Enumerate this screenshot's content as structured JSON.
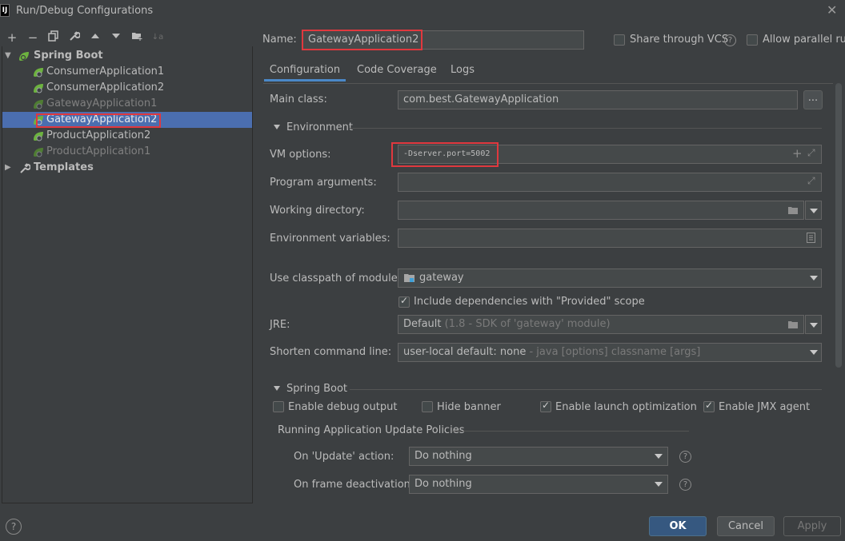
{
  "window": {
    "title": "Run/Debug Configurations",
    "app_icon_text": "IJ"
  },
  "tree": {
    "root_label": "Spring Boot",
    "items": [
      {
        "label": "ConsumerApplication1",
        "muted": false
      },
      {
        "label": "ConsumerApplication2",
        "muted": false
      },
      {
        "label": "GatewayApplication1",
        "muted": true
      },
      {
        "label": "GatewayApplication2",
        "muted": false,
        "selected": true
      },
      {
        "label": "ProductApplication2",
        "muted": false
      },
      {
        "label": "ProductApplication1",
        "muted": true
      }
    ],
    "templates_label": "Templates"
  },
  "header": {
    "name_label": "Name:",
    "name_value": "GatewayApplication2",
    "share_vcs_label": "Share through VCS",
    "allow_parallel_label": "Allow parallel run"
  },
  "tabs": [
    {
      "label": "Configuration",
      "active": true
    },
    {
      "label": "Code Coverage",
      "active": false
    },
    {
      "label": "Logs",
      "active": false
    }
  ],
  "config": {
    "main_class_label": "Main class:",
    "main_class_value": "com.best.GatewayApplication",
    "browse_label": "...",
    "environment_label": "Environment",
    "vm_options_label": "VM options:",
    "vm_options_value": "-Dserver.port=5002",
    "program_args_label": "Program arguments:",
    "working_dir_label": "Working directory:",
    "env_vars_label": "Environment variables:",
    "classpath_label": "Use classpath of module:",
    "classpath_value": "gateway",
    "include_deps_label": "Include dependencies with \"Provided\" scope",
    "jre_label": "JRE:",
    "jre_value": "Default",
    "jre_hint": "(1.8 - SDK of 'gateway' module)",
    "shorten_label": "Shorten command line:",
    "shorten_value": "user-local default: none",
    "shorten_hint": "- java [options] classname [args]"
  },
  "spring_boot": {
    "section_label": "Spring Boot",
    "debug_output_label": "Enable debug output",
    "hide_banner_label": "Hide banner",
    "launch_opt_label": "Enable launch optimization",
    "jmx_label": "Enable JMX agent",
    "policies_label": "Running Application Update Policies",
    "update_action_label": "On 'Update' action:",
    "update_action_value": "Do nothing",
    "frame_deactivation_label": "On frame deactivation:",
    "frame_deactivation_value": "Do nothing"
  },
  "buttons": {
    "ok": "OK",
    "cancel": "Cancel",
    "apply": "Apply",
    "help": "?"
  }
}
